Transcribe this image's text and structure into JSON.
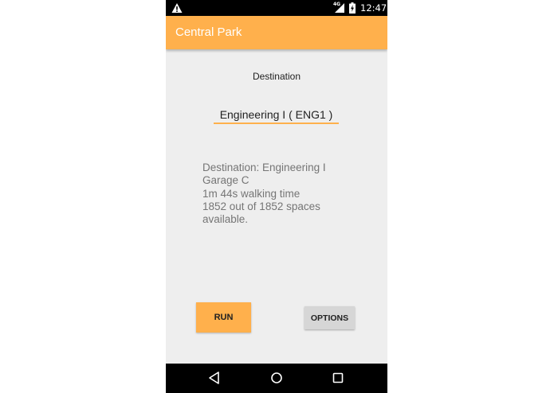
{
  "status_bar": {
    "network": "4G",
    "time": "12:47"
  },
  "app_bar": {
    "title": "Central Park"
  },
  "form": {
    "destination_label": "Destination",
    "destination_value": "Engineering I ( ENG1 )"
  },
  "result": {
    "lines": [
      "Destination: Engineering I",
      "Garage C",
      "1m 44s walking time",
      "1852 out of 1852 spaces",
      "available."
    ]
  },
  "buttons": {
    "run_label": "RUN",
    "options_label": "OPTIONS"
  },
  "colors": {
    "accent": "#ffb04c",
    "background": "#eeeeee",
    "bars": "#000000"
  },
  "icons": {
    "status_left": "warning-icon",
    "status_signal": "signal-icon",
    "status_battery": "battery-charging-icon",
    "nav_back": "back-triangle-icon",
    "nav_home": "home-circle-icon",
    "nav_recents": "recents-square-icon"
  }
}
